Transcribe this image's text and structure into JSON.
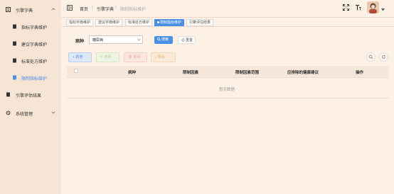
{
  "sidebar": {
    "groups": [
      {
        "label": "引擎字典",
        "expanded": true,
        "icon": "book-icon"
      },
      {
        "label": "引擎评估结果",
        "icon": "document-icon"
      },
      {
        "label": "系统管理",
        "expanded": false,
        "icon": "gear-icon"
      }
    ],
    "items": [
      {
        "label": "指标字典维护",
        "active": false,
        "icon": "file-icon"
      },
      {
        "label": "建议字典维护",
        "active": false,
        "icon": "file-icon"
      },
      {
        "label": "标准处方维护",
        "active": false,
        "icon": "file-icon"
      },
      {
        "label": "限制指标维护",
        "active": true,
        "icon": "file-icon"
      }
    ]
  },
  "header": {
    "breadcrumb": [
      "首页",
      "引擎字典",
      "限制指标维护"
    ],
    "separator": "/",
    "icons": [
      "fullscreen-icon",
      "font-size-icon",
      "avatar",
      "chevron-down-icon"
    ]
  },
  "tags": [
    {
      "label": "指标字典维护",
      "active": false
    },
    {
      "label": "建议字典维护",
      "active": false
    },
    {
      "label": "标准处方维护",
      "active": false
    },
    {
      "label": "限制指标维护",
      "active": true
    },
    {
      "label": "引擎评估结果",
      "active": false
    }
  ],
  "filter": {
    "label": "病种",
    "value": "糖尿病",
    "search_label": "搜索",
    "reset_label": "重置"
  },
  "toolbar": {
    "add_label": "新增",
    "edit_label": "修改",
    "delete_label": "删除",
    "export_label": "导出"
  },
  "table": {
    "columns": [
      "病种",
      "限制因素",
      "限制因素范围",
      "应排除的健康建议",
      "操作"
    ],
    "rows": [],
    "empty_text": "暂无数据"
  },
  "colors": {
    "primary": "#4a8fe6",
    "sidebar_bg": "#f6e4d4",
    "page_bg": "#fdf1e6"
  }
}
